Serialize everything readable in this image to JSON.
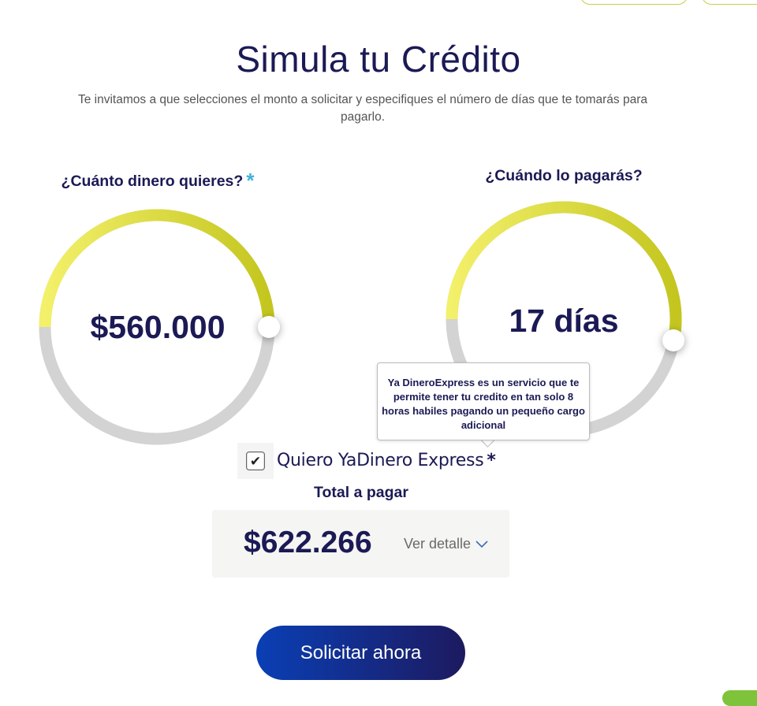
{
  "title": "Simula tu Crédito",
  "subtitle": "Te invitamos a que selecciones el monto a solicitar y especifiques el número de días que te tomarás para pagarlo.",
  "amount_dial": {
    "label": "¿Cuánto dinero quieres?",
    "required_mark": "*",
    "value": "$560.000",
    "fill_fraction": 0.5
  },
  "days_dial": {
    "label": "¿Cuándo lo pagarás?",
    "value": "17 días",
    "fill_fraction": 0.53
  },
  "express": {
    "checked": true,
    "label": "Quiero YaDinero Express",
    "required_mark": "*",
    "tooltip": "Ya DineroExpress es un servicio que te permite tener tu credito en tan solo 8 horas habiles pagando un pequeño cargo adicional"
  },
  "total": {
    "label": "Total a pagar",
    "amount": "$622.266",
    "detail_link": "Ver detalle"
  },
  "submit_button": "Solicitar ahora",
  "colors": {
    "navy": "#1b1a55",
    "track": "#d3d3d3",
    "fill_light": "#f3f06a",
    "fill_dark": "#c4c61f",
    "accent_blue": "#3fb3d6",
    "button_start": "#0a3fb5",
    "button_end": "#1d1a5f"
  },
  "icons": {
    "check": "check-icon",
    "chevron": "chevron-down-icon"
  }
}
